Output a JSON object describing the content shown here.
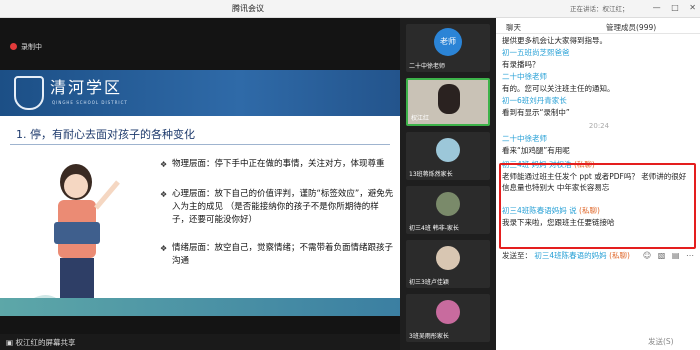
{
  "window": {
    "title": "腾讯会议",
    "min": "—",
    "max": "□",
    "close": "✕"
  },
  "stage": {
    "recording": "录制中",
    "share_label": "权江红的屏幕共享",
    "slide": {
      "logo_text": "清河学区",
      "logo_sub": "QINGHE SCHOOL DISTRICT",
      "heading": "1. 停，有耐心去面对孩子的各种变化",
      "bullets": [
        "物理层面：停下手中正在做的事情，关注对方，体现尊重",
        "心理层面：放下自己的价值评判，谨防“标签效应”，避免先入为主的成见 （是否能接纳你的孩子不是你所期待的样子，还要可能没你好）",
        "情绪层面：放空自己，觉察情绪；不需带着负面情绪跟孩子沟通"
      ]
    }
  },
  "participants": [
    {
      "label": "二十中徐老师",
      "avatar": "老师"
    },
    {
      "label": "权江红"
    },
    {
      "label": "13班蒋烁然家长"
    },
    {
      "label": "初三4班 韩非-家长"
    },
    {
      "label": "初三3班卢佳颖"
    },
    {
      "label": "3班吴雨彤家长"
    }
  ],
  "chat": {
    "tab_chat": "聊天",
    "tab_members": "管理成员(999)",
    "notice": "正在讲话：权江红；",
    "messages": [
      {
        "text": "提供更多机会让大家得到指导。"
      },
      {
        "name": "初一五班尚芝熙爸爸"
      },
      {
        "text": "有录播吗？"
      },
      {
        "name": "二十中徐老师"
      },
      {
        "text": "有的。您可以关注班主任的通知。"
      },
      {
        "name": "初一6班刘丹青家长"
      },
      {
        "text": "看到有显示“录制中”"
      },
      {
        "time": "20:24"
      },
      {
        "name": "二十中徐老师"
      },
      {
        "text": "看来“加鸡腿”有用呢"
      }
    ],
    "private_msgs": [
      {
        "name": "初三4班 妈妈 对权浩",
        "tag": "(私聊)",
        "text": "老师能通过班主任发个 ppt 或者PDF吗？ 老师讲的很好 信息量也特别大 中年家长容易忘"
      },
      {
        "name": "初三4班陈春语妈妈 说",
        "tag": "(私聊)",
        "text": "我录下来啦，您跟班主任要链接哈"
      }
    ],
    "send_to_label": "发送至：",
    "send_to_target": "初三4班陈春语的妈妈",
    "send_to_tag": "(私聊)",
    "send_button": "发送(S)"
  }
}
